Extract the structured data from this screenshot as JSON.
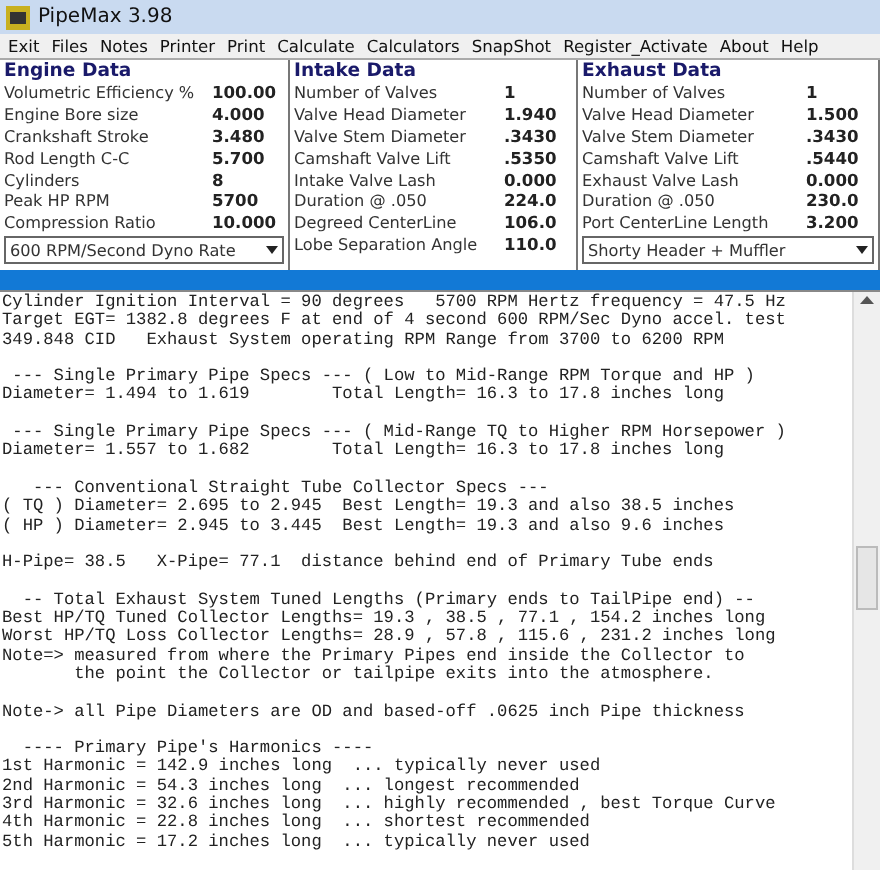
{
  "window": {
    "title": "PipeMax 3.98"
  },
  "menu": [
    "Exit",
    "Files",
    "Notes",
    "Printer",
    "Print",
    "Calculate",
    "Calculators",
    "SnapShot",
    "Register_Activate",
    "About",
    "Help"
  ],
  "panels": [
    {
      "title": "Engine Data",
      "rows": [
        {
          "label": "Volumetric Efficiency %",
          "value": "100.00"
        },
        {
          "label": "Engine Bore size",
          "value": "4.000"
        },
        {
          "label": "Crankshaft Stroke",
          "value": "3.480"
        },
        {
          "label": "Rod Length C-C",
          "value": "5.700"
        },
        {
          "label": "Cylinders",
          "value": "8"
        },
        {
          "label": "Peak HP RPM",
          "value": "5700"
        },
        {
          "label": "Compression Ratio",
          "value": "10.000"
        }
      ],
      "dropdown": "600 RPM/Second Dyno Rate"
    },
    {
      "title": "Intake Data",
      "rows": [
        {
          "label": "Number of Valves",
          "value": "1"
        },
        {
          "label": "Valve Head Diameter",
          "value": "1.940"
        },
        {
          "label": "Valve Stem Diameter",
          "value": ".3430"
        },
        {
          "label": "Camshaft Valve Lift",
          "value": ".5350"
        },
        {
          "label": "Intake Valve Lash",
          "value": "0.000"
        },
        {
          "label": "Duration @ .050",
          "value": "224.0"
        },
        {
          "label": "Degreed CenterLine",
          "value": "106.0"
        },
        {
          "label": "Lobe Separation Angle",
          "value": "110.0"
        }
      ]
    },
    {
      "title": "Exhaust Data",
      "rows": [
        {
          "label": "Number of Valves",
          "value": "1"
        },
        {
          "label": "Valve Head Diameter",
          "value": "1.500"
        },
        {
          "label": "Valve Stem Diameter",
          "value": ".3430"
        },
        {
          "label": "Camshaft Valve Lift",
          "value": ".5440"
        },
        {
          "label": "Exhaust Valve Lash",
          "value": "0.000"
        },
        {
          "label": "Duration @ .050",
          "value": "230.0"
        },
        {
          "label": "Port CenterLine Length",
          "value": "3.200"
        }
      ],
      "dropdown": "Shorty Header + Muffler"
    }
  ],
  "output": [
    [
      "Cylinder Ignition Interval = 90 degrees   5700 RPM Hertz frequency = 47.5 Hz",
      "Target EGT= 1382.8 degrees F at end of 4 second 600 RPM/Sec Dyno accel. test",
      "349.848 CID   Exhaust System operating RPM Range from 3700 to 6200 RPM"
    ],
    [
      " --- Single Primary Pipe Specs --- ( Low to Mid-Range RPM Torque and HP )",
      "Diameter= 1.494 to 1.619        Total Length= 16.3 to 17.8 inches long"
    ],
    [
      " --- Single Primary Pipe Specs --- ( Mid-Range TQ to Higher RPM Horsepower )",
      "Diameter= 1.557 to 1.682        Total Length= 16.3 to 17.8 inches long"
    ],
    [
      "   --- Conventional Straight Tube Collector Specs ---",
      "( TQ ) Diameter= 2.695 to 2.945  Best Length= 19.3 and also 38.5 inches",
      "( HP ) Diameter= 2.945 to 3.445  Best Length= 19.3 and also 9.6 inches"
    ],
    [
      "H-Pipe= 38.5   X-Pipe= 77.1  distance behind end of Primary Tube ends"
    ],
    [
      "  -- Total Exhaust System Tuned Lengths (Primary ends to TailPipe end) --",
      "Best HP/TQ Tuned Collector Lengths= 19.3 , 38.5 , 77.1 , 154.2 inches long",
      "Worst HP/TQ Loss Collector Lengths= 28.9 , 57.8 , 115.6 , 231.2 inches long",
      "Note=> measured from where the Primary Pipes end inside the Collector to",
      "       the point the Collector or tailpipe exits into the atmosphere."
    ],
    [
      "Note-> all Pipe Diameters are OD and based-off .0625 inch Pipe thickness"
    ],
    [
      "  ---- Primary Pipe's Harmonics ----",
      "1st Harmonic = 142.9 inches long  ... typically never used",
      "2nd Harmonic = 54.3 inches long  ... longest recommended",
      "3rd Harmonic = 32.6 inches long  ... highly recommended , best Torque Curve",
      "4th Harmonic = 22.8 inches long  ... shortest recommended",
      "5th Harmonic = 17.2 inches long  ... typically never used"
    ]
  ]
}
